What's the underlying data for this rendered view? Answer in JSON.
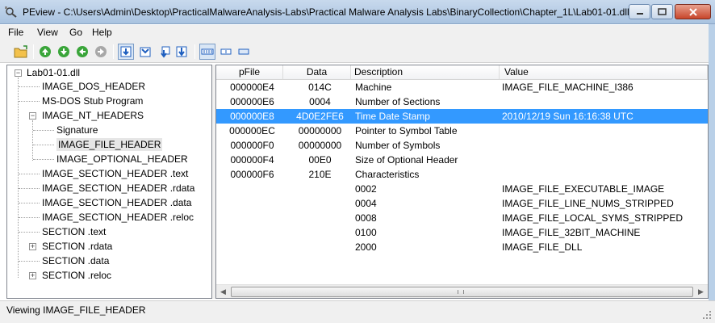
{
  "window": {
    "title": "PEview - C:\\Users\\Admin\\Desktop\\PracticalMalwareAnalysis-Labs\\Practical Malware Analysis Labs\\BinaryCollection\\Chapter_1L\\Lab01-01.dll"
  },
  "menu": [
    "File",
    "View",
    "Go",
    "Help"
  ],
  "toolbar_icons": [
    "open-file-icon",
    "back-icon",
    "forward-icon",
    "back-alt-icon",
    "forward-disabled-icon",
    "view-byte-icon",
    "view-word-icon",
    "view-dword-icon",
    "view-qword-icon",
    "view-detail-icon",
    "view-list-icon",
    "view-small-icon"
  ],
  "tree": {
    "root": "Lab01-01.dll",
    "items": [
      "IMAGE_DOS_HEADER",
      "MS-DOS Stub Program",
      "IMAGE_NT_HEADERS",
      "Signature",
      "IMAGE_FILE_HEADER",
      "IMAGE_OPTIONAL_HEADER",
      "IMAGE_SECTION_HEADER .text",
      "IMAGE_SECTION_HEADER .rdata",
      "IMAGE_SECTION_HEADER .data",
      "IMAGE_SECTION_HEADER .reloc",
      "SECTION .text",
      "SECTION .rdata",
      "SECTION .data",
      "SECTION .reloc"
    ],
    "selected": "IMAGE_FILE_HEADER"
  },
  "table": {
    "columns": [
      "pFile",
      "Data",
      "Description",
      "Value"
    ],
    "rows": [
      [
        "000000E4",
        "014C",
        "Machine",
        "IMAGE_FILE_MACHINE_I386"
      ],
      [
        "000000E6",
        "0004",
        "Number of Sections",
        ""
      ],
      [
        "000000E8",
        "4D0E2FE6",
        "Time Date Stamp",
        "2010/12/19 Sun 16:16:38 UTC"
      ],
      [
        "000000EC",
        "00000000",
        "Pointer to Symbol Table",
        ""
      ],
      [
        "000000F0",
        "00000000",
        "Number of Symbols",
        ""
      ],
      [
        "000000F4",
        "00E0",
        "Size of Optional Header",
        ""
      ],
      [
        "000000F6",
        "210E",
        "Characteristics",
        ""
      ],
      [
        "",
        "",
        "0002",
        "IMAGE_FILE_EXECUTABLE_IMAGE"
      ],
      [
        "",
        "",
        "0004",
        "IMAGE_FILE_LINE_NUMS_STRIPPED"
      ],
      [
        "",
        "",
        "0008",
        "IMAGE_FILE_LOCAL_SYMS_STRIPPED"
      ],
      [
        "",
        "",
        "0100",
        "IMAGE_FILE_32BIT_MACHINE"
      ],
      [
        "",
        "",
        "2000",
        "IMAGE_FILE_DLL"
      ]
    ],
    "selected_row": 2
  },
  "status": "Viewing IMAGE_FILE_HEADER",
  "colors": {
    "selection": "#3399ff",
    "titlebar": "#b9d0e8"
  }
}
